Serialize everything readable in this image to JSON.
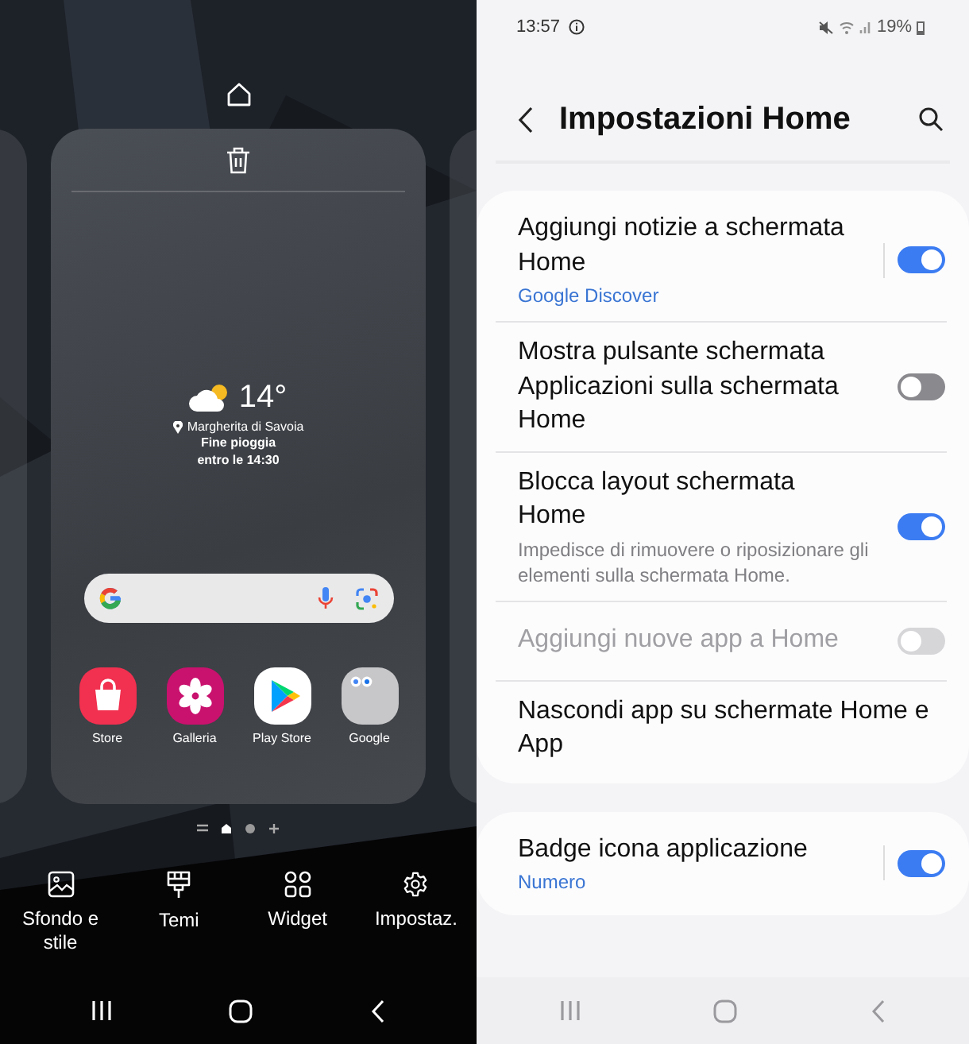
{
  "home_editor": {
    "weather": {
      "temperature": "14°",
      "location": "Margherita di Savoia",
      "forecast": [
        "Fine pioggia",
        "entro le 14:30"
      ]
    },
    "apps": [
      {
        "label": "Store",
        "kind": "store"
      },
      {
        "label": "Galleria",
        "kind": "gallery"
      },
      {
        "label": "Play Store",
        "kind": "play"
      },
      {
        "label": "Google",
        "kind": "folder"
      }
    ],
    "page_indicator": [
      {
        "kind": "list",
        "selected": false
      },
      {
        "kind": "home",
        "selected": true
      },
      {
        "kind": "dot",
        "selected": false
      },
      {
        "kind": "add",
        "selected": false
      }
    ],
    "actions": [
      {
        "label": "Sfondo e stile",
        "kind": "wallpaper"
      },
      {
        "label": "Temi",
        "kind": "theme"
      },
      {
        "label": "Widget",
        "kind": "widget"
      },
      {
        "label": "Impostaz.",
        "kind": "settings"
      }
    ]
  },
  "settings": {
    "status_bar": {
      "time": "13:57",
      "battery": "19%"
    },
    "title": "Impostazioni Home",
    "groups": [
      [
        {
          "title": "Aggiungi notizie a schermata Home",
          "subtitle": "Google Discover",
          "kind": "link",
          "on": true,
          "disabled": false,
          "divider": true
        },
        {
          "title": "Mostra pulsante schermata Applicazioni sulla schermata Home",
          "on": false,
          "disabled": false,
          "divider": false
        },
        {
          "title": "Blocca layout schermata Home",
          "subtitle": "Impedisce di rimuovere o riposizionare gli elementi sulla schermata Home.",
          "kind": "description",
          "on": true,
          "disabled": false,
          "divider": false
        },
        {
          "title": "Aggiungi nuove app a Home",
          "on": false,
          "disabled": true,
          "divider": false
        },
        {
          "title": "Nascondi app su schermate Home e App"
        }
      ],
      [
        {
          "title": "Badge icona applicazione",
          "subtitle": "Numero",
          "kind": "link",
          "on": true,
          "disabled": false,
          "divider": true
        }
      ]
    ]
  }
}
